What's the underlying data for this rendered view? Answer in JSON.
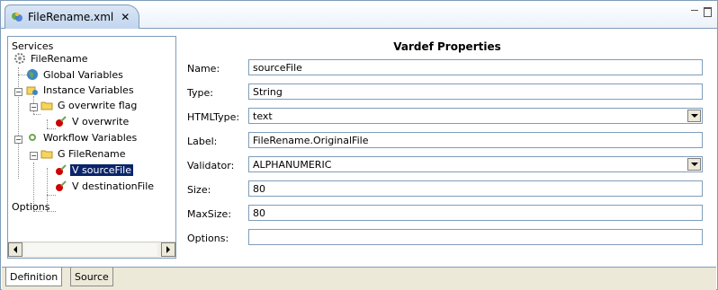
{
  "editor": {
    "tab_title": "FileRename.xml",
    "close_glyph": "✕"
  },
  "tree": {
    "root_label": "Services",
    "items": [
      {
        "label": "FileRename",
        "icon": "gear-service-icon"
      },
      {
        "label": "Global Variables",
        "icon": "globe-icon"
      },
      {
        "label": "Instance Variables",
        "icon": "instance-folder-icon"
      },
      {
        "label": "G overwrite flag",
        "icon": "folder-group-icon"
      },
      {
        "label": "V overwrite",
        "icon": "variable-icon"
      },
      {
        "label": "Workflow Variables",
        "icon": "workflow-icon"
      },
      {
        "label": "G FileRename",
        "icon": "folder-group-icon"
      },
      {
        "label": "V sourceFile",
        "icon": "variable-icon",
        "selected": true
      },
      {
        "label": "V destinationFile",
        "icon": "variable-icon"
      }
    ],
    "options_label": "Options"
  },
  "properties": {
    "title": "Vardef Properties",
    "fields": {
      "name": {
        "label": "Name:",
        "value": "sourceFile"
      },
      "type": {
        "label": "Type:",
        "value": "String"
      },
      "htmltype": {
        "label": "HTMLType:",
        "value": "text"
      },
      "label": {
        "label": "Label:",
        "value": "FileRename.OriginalFile"
      },
      "validator": {
        "label": "Validator:",
        "value": "ALPHANUMERIC"
      },
      "size": {
        "label": "Size:",
        "value": "80"
      },
      "maxsize": {
        "label": "MaxSize:",
        "value": "80"
      },
      "options": {
        "label": "Options:",
        "value": ""
      }
    }
  },
  "bottom_tabs": {
    "definition": "Definition",
    "source": "Source"
  },
  "colors": {
    "selection": "#0a246a",
    "border": "#7f9db9"
  }
}
